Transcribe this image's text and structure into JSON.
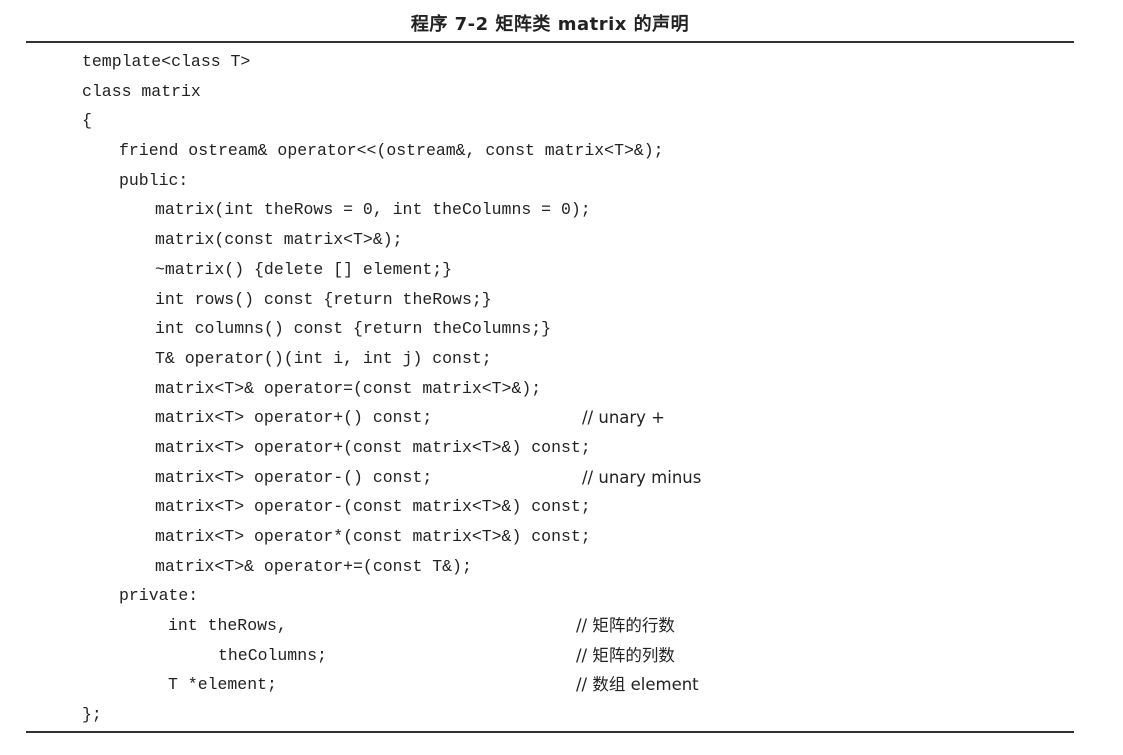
{
  "caption": "程序 7-2   矩阵类 matrix 的声明",
  "code_lines": [
    {
      "text": "template<class T>",
      "comment": ""
    },
    {
      "text": "class matrix",
      "comment": ""
    },
    {
      "text": "{",
      "comment": ""
    },
    {
      "text": "friend ostream& operator<<(ostream&, const matrix<T>&);",
      "comment": ""
    },
    {
      "text": "public:",
      "comment": ""
    },
    {
      "text": "matrix(int theRows = 0, int theColumns = 0);",
      "comment": ""
    },
    {
      "text": "matrix(const matrix<T>&);",
      "comment": ""
    },
    {
      "text": "~matrix() {delete [] element;}",
      "comment": ""
    },
    {
      "text": "int rows() const {return theRows;}",
      "comment": ""
    },
    {
      "text": "int columns() const {return theColumns;}",
      "comment": ""
    },
    {
      "text": "T& operator()(int i, int j) const;",
      "comment": ""
    },
    {
      "text": "matrix<T>& operator=(const matrix<T>&);",
      "comment": ""
    },
    {
      "text": "matrix<T> operator+() const;",
      "comment": "// unary +"
    },
    {
      "text": "matrix<T> operator+(const matrix<T>&) const;",
      "comment": ""
    },
    {
      "text": "matrix<T> operator-() const;",
      "comment": "// unary minus"
    },
    {
      "text": "matrix<T> operator-(const matrix<T>&) const;",
      "comment": ""
    },
    {
      "text": "matrix<T> operator*(const matrix<T>&) const;",
      "comment": ""
    },
    {
      "text": "matrix<T>& operator+=(const T&);",
      "comment": ""
    },
    {
      "text": "private:",
      "comment": ""
    },
    {
      "text": "int theRows,",
      "comment": "// 矩阵的行数"
    },
    {
      "text": "theColumns;",
      "comment": "// 矩阵的列数"
    },
    {
      "text": "T *element;",
      "comment": "// 数组 element"
    },
    {
      "text": "};",
      "comment": ""
    }
  ]
}
